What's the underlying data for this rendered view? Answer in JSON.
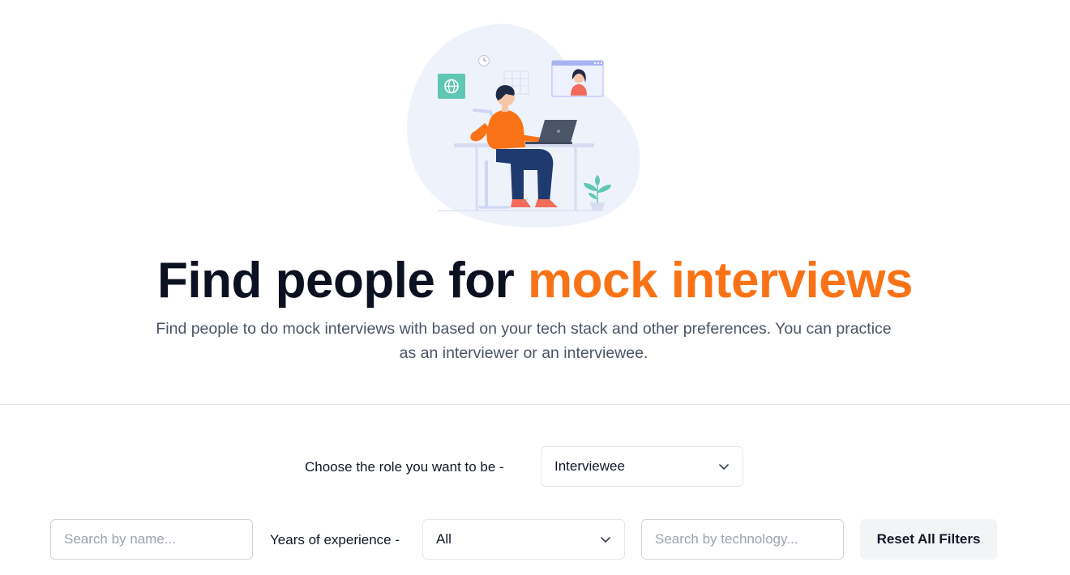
{
  "hero": {
    "illustration": "person-with-laptop-video-call-illustration",
    "headline_main": "Find people for ",
    "headline_accent": "mock interviews",
    "subtitle": "Find people to do mock interviews with based on your tech stack and other preferences. You can practice as an interviewer or an interviewee."
  },
  "filters": {
    "role_label": "Choose the role you want to be -",
    "role_value": "Interviewee",
    "name_placeholder": "Search by name...",
    "experience_label": "Years of experience -",
    "experience_value": "All",
    "tech_placeholder": "Search by technology...",
    "reset_label": "Reset All Filters"
  },
  "colors": {
    "accent": "#f97316",
    "heading": "#0b1120",
    "subtitle": "#4b5563",
    "button_bg": "#f3f4f6"
  },
  "icons": {
    "dropdown": "chevron-down-icon"
  }
}
